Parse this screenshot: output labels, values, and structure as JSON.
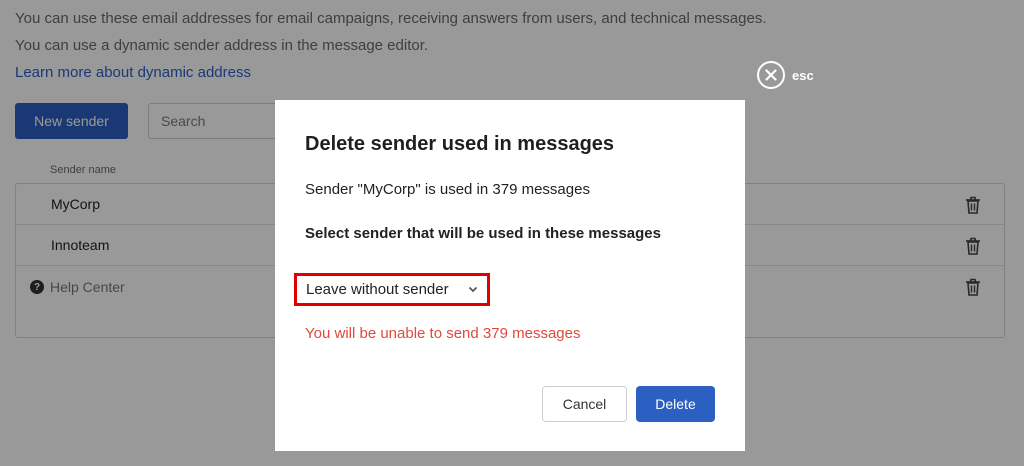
{
  "background": {
    "info_line_1": "You can use these email addresses for email campaigns, receiving answers from users, and technical messages.",
    "info_line_2": "You can use a dynamic sender address in the message editor.",
    "learn_more_link": "Learn more about dynamic address",
    "new_sender_label": "New sender",
    "search_placeholder": "Search",
    "column_header": "Sender name",
    "rows": [
      {
        "name": "MyCorp"
      },
      {
        "name": "Innoteam"
      }
    ],
    "help_label": "Help Center"
  },
  "close": {
    "label": "esc",
    "icon": "close-icon"
  },
  "modal": {
    "title": "Delete sender used in messages",
    "description": "Sender \"MyCorp\" is used in 379 messages",
    "select_label": "Select sender that will be used in these messages",
    "select_value": "Leave without sender",
    "warning": "You will be unable to send 379 messages",
    "cancel_label": "Cancel",
    "delete_label": "Delete"
  },
  "colors": {
    "accent": "#2c5fc2",
    "warning": "#e2483b",
    "highlight": "#e00000"
  }
}
